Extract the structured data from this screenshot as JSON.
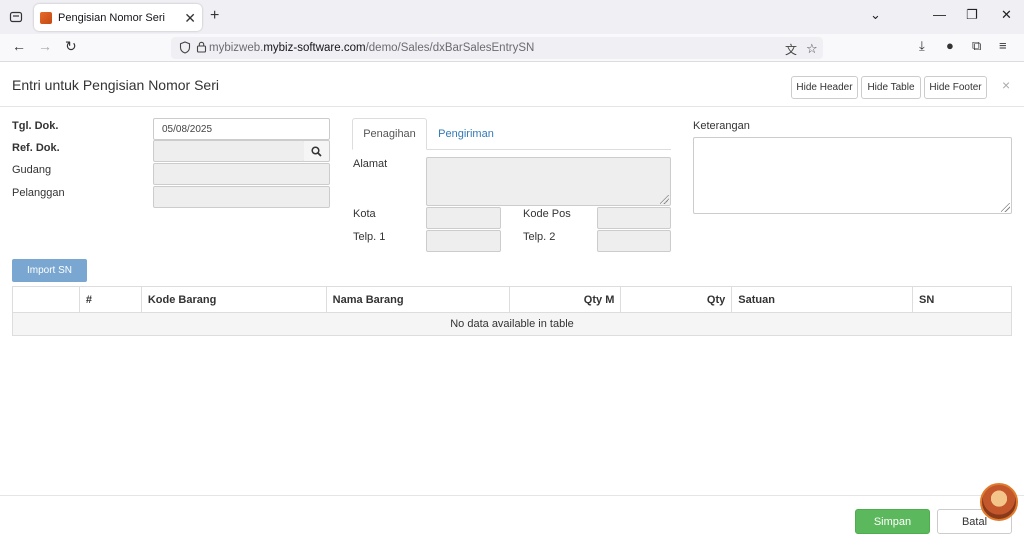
{
  "browser": {
    "tab_title": "Pengisian Nomor Seri",
    "url_prefix": "mybizweb.",
    "url_domain": "mybiz-software.com",
    "url_path": "/demo/Sales/dxBarSalesEntrySN"
  },
  "modal": {
    "title": "Entri untuk Pengisian Nomor Seri",
    "hide_header": "Hide Header",
    "hide_table": "Hide Table",
    "hide_footer": "Hide Footer",
    "close": "×"
  },
  "form": {
    "tgl_dok_label": "Tgl. Dok.",
    "tgl_dok_value": "05/08/2025",
    "ref_dok_label": "Ref. Dok.",
    "ref_dok_value": "",
    "gudang_label": "Gudang",
    "gudang_value": "",
    "pelanggan_label": "Pelanggan",
    "pelanggan_value": ""
  },
  "address_tabs": {
    "tab_billing": "Penagihan",
    "tab_shipping": "Pengiriman",
    "alamat_label": "Alamat",
    "kota_label": "Kota",
    "kode_pos_label": "Kode Pos",
    "telp1_label": "Telp. 1",
    "telp2_label": "Telp. 2"
  },
  "notes": {
    "keterangan_label": "Keterangan"
  },
  "table": {
    "import_label": "Import SN",
    "columns": [
      "",
      "#",
      "Kode Barang",
      "Nama Barang",
      "Qty M",
      "Qty",
      "Satuan",
      "SN"
    ],
    "empty_message": "No data available in table"
  },
  "footer": {
    "save_label": "Simpan",
    "cancel_label": "Batal"
  },
  "colors": {
    "save_button": "#5cb85c",
    "import_button": "#7aa7d1",
    "link_tab": "#337ab7"
  }
}
